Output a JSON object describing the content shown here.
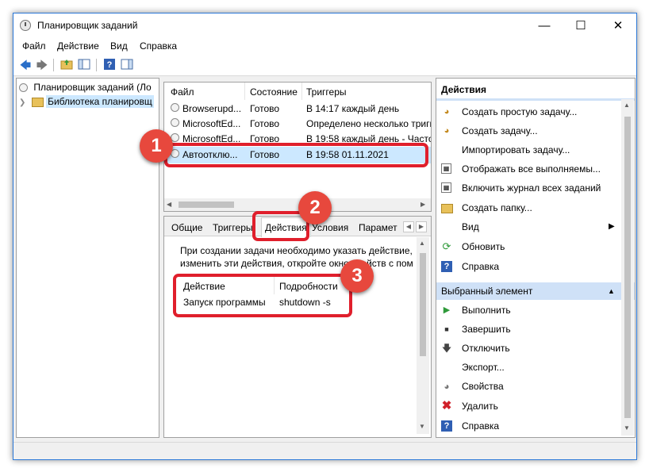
{
  "window": {
    "title": "Планировщик заданий"
  },
  "menu": [
    "Файл",
    "Действие",
    "Вид",
    "Справка"
  ],
  "tree": {
    "root": "Планировщик заданий (Ло",
    "library": "Библиотека планировщ"
  },
  "task_list": {
    "columns": [
      "Файл",
      "Состояние",
      "Триггеры"
    ],
    "rows": [
      {
        "name": "Browserupd...",
        "state": "Готово",
        "trigger": "В 14:17 каждый день"
      },
      {
        "name": "MicrosoftEd...",
        "state": "Готово",
        "trigger": "Определено несколько тригге"
      },
      {
        "name": "MicrosoftEd...",
        "state": "Готово",
        "trigger": "В 19:58 каждый день - Часто"
      },
      {
        "name": "Автоотклю...",
        "state": "Готово",
        "trigger": "В 19:58 01.11.2021"
      }
    ]
  },
  "detail_tabs": [
    "Общие",
    "Триггеры",
    "Действия",
    "Условия",
    "Парамет"
  ],
  "detail": {
    "description": "При создании задачи необходимо указать действие, и",
    "description2": "изменить эти действия, откройте окно свойств с пом",
    "columns": [
      "Действие",
      "Подробности"
    ],
    "action_row": {
      "action": "Запуск программы",
      "details": "shutdown -s"
    }
  },
  "actions_panel": {
    "title": "Действия",
    "items": [
      {
        "icon": "create-basic-task-icon",
        "label": "Создать простую задачу..."
      },
      {
        "icon": "create-task-icon",
        "label": "Создать задачу..."
      },
      {
        "icon": "",
        "label": "Импортировать задачу..."
      },
      {
        "icon": "display-running-icon",
        "label": "Отображать все выполняемы..."
      },
      {
        "icon": "enable-history-icon",
        "label": "Включить журнал всех заданий"
      },
      {
        "icon": "new-folder-icon",
        "label": "Создать папку..."
      },
      {
        "icon": "",
        "label": "Вид"
      },
      {
        "icon": "refresh-icon",
        "label": "Обновить"
      },
      {
        "icon": "help-icon",
        "label": "Справка"
      }
    ],
    "selected_title": "Выбранный элемент",
    "selected_items": [
      {
        "icon": "run-icon",
        "label": "Выполнить"
      },
      {
        "icon": "end-icon",
        "label": "Завершить"
      },
      {
        "icon": "disable-icon",
        "label": "Отключить"
      },
      {
        "icon": "",
        "label": "Экспорт..."
      },
      {
        "icon": "properties-icon",
        "label": "Свойства"
      },
      {
        "icon": "delete-icon",
        "label": "Удалить"
      },
      {
        "icon": "help-icon",
        "label": "Справка"
      }
    ]
  },
  "badges": [
    "1",
    "2",
    "3"
  ],
  "colors": {
    "accent": "#e01f2c",
    "badge": "#e7483d",
    "section_header": "#cfe1f7",
    "selection": "#cce8ff"
  }
}
